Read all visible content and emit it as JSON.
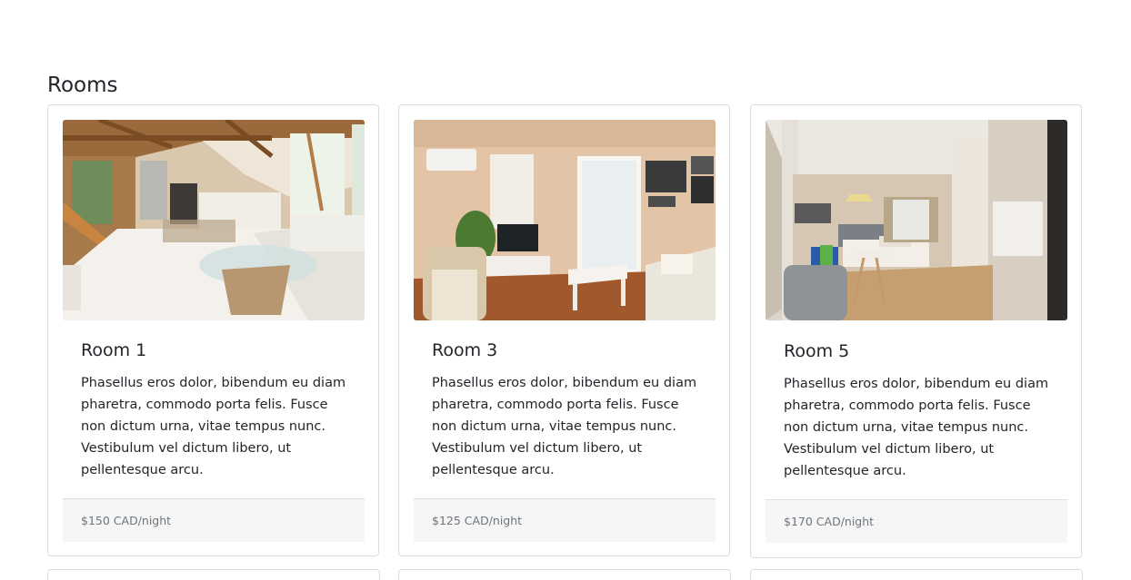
{
  "section": {
    "title": "Rooms"
  },
  "rooms": [
    {
      "title": "Room 1",
      "description": "Phasellus eros dolor, bibendum eu diam pharetra, commodo porta felis. Fusce non dictum urna, vitae tempus nunc. Vestibulum vel dictum libero, ut pellentesque arcu.",
      "price": "$150 CAD/night"
    },
    {
      "title": "Room 3",
      "description": "Phasellus eros dolor, bibendum eu diam pharetra, commodo porta felis. Fusce non dictum urna, vitae tempus nunc. Vestibulum vel dictum libero, ut pellentesque arcu.",
      "price": "$125 CAD/night"
    },
    {
      "title": "Room 5",
      "description": "Phasellus eros dolor, bibendum eu diam pharetra, commodo porta felis. Fusce non dictum urna, vitae tempus nunc. Vestibulum vel dictum libero, ut pellentesque arcu.",
      "price": "$170 CAD/night"
    }
  ],
  "colors": {
    "text": "#212529",
    "muted": "#6c757d",
    "border": "#dcdcdc",
    "footer_bg": "#f6f6f6"
  }
}
